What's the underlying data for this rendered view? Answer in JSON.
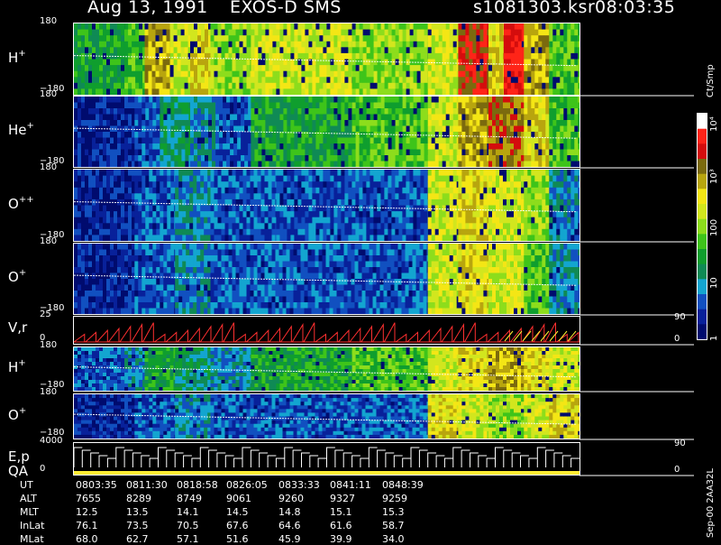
{
  "title": {
    "date": "Aug 13, 1991",
    "instrument": "EXOS-D SMS",
    "file": "s1081303.ksr",
    "time": "08:03:35"
  },
  "colorbar": {
    "unit": "Ct/Smp",
    "ticks": [
      "1",
      "10",
      "100",
      "10³",
      "10⁴"
    ],
    "colors": [
      "#000b6e",
      "#08219a",
      "#1150c0",
      "#13a5d0",
      "#0f8a55",
      "#0f9e2e",
      "#3ec41a",
      "#8ddd1c",
      "#d2e61e",
      "#f4e615",
      "#b8a50e",
      "#7b6a0e",
      "#d40d0d",
      "#ff2418",
      "#ffffff"
    ]
  },
  "bottom_label": "Sep-00  2AA32L",
  "panels": [
    {
      "id": "h1",
      "label": "H",
      "charge": "+",
      "ymax": "180",
      "ymin": "−180"
    },
    {
      "id": "he",
      "label": "He",
      "charge": "+",
      "ymax": "180",
      "ymin": "−180"
    },
    {
      "id": "oo",
      "label": "O",
      "charge": "++",
      "ymax": "180",
      "ymin": "−180"
    },
    {
      "id": "o1",
      "label": "O",
      "charge": "+",
      "ymax": "180",
      "ymin": "−180"
    },
    {
      "id": "vr",
      "label": "V,r",
      "charge": "",
      "ymax": "25",
      "ymin": "0",
      "right_top": "90",
      "right_bottom": "0"
    },
    {
      "id": "h2",
      "label": "H",
      "charge": "+",
      "ymax": "180",
      "ymin": "−180"
    },
    {
      "id": "o2",
      "label": "O",
      "charge": "+",
      "ymax": "180",
      "ymin": "−180"
    },
    {
      "id": "ep",
      "label": "E,p",
      "label2": "QA",
      "charge": "",
      "ymax": "4000",
      "ymin": "0",
      "right_top": "90",
      "right_bottom": "0"
    }
  ],
  "ephemeris": {
    "rows": [
      {
        "name": "UT",
        "values": [
          "0803:35",
          "0811:30",
          "0818:58",
          "0826:05",
          "0833:33",
          "0841:11",
          "0848:39"
        ]
      },
      {
        "name": "ALT",
        "values": [
          "7655",
          "8289",
          "8749",
          "9061",
          "9260",
          "9327",
          "9259"
        ]
      },
      {
        "name": "MLT",
        "values": [
          "12.5",
          "13.5",
          "14.1",
          "14.5",
          "14.8",
          "15.1",
          "15.3"
        ]
      },
      {
        "name": "InLat",
        "values": [
          "76.1",
          "73.5",
          "70.5",
          "67.6",
          "64.6",
          "61.6",
          "58.7"
        ]
      },
      {
        "name": "MLat",
        "values": [
          "68.0",
          "62.7",
          "57.1",
          "51.6",
          "45.9",
          "39.9",
          "34.0"
        ]
      }
    ]
  },
  "chart_data": {
    "type": "heatmap",
    "x_axis": "UT",
    "x_ticks": [
      "0803:35",
      "0811:30",
      "0818:58",
      "0826:05",
      "0833:33",
      "0841:11",
      "0848:39"
    ],
    "colorbar_range": [
      1,
      10000
    ],
    "colorbar_scale": "log",
    "panels": [
      {
        "name": "H+",
        "ylim": [
          -180,
          180
        ],
        "segments": [
          {
            "x0": 0.0,
            "x1": 0.1,
            "level": 5
          },
          {
            "x0": 0.1,
            "x1": 0.14,
            "level": 6
          },
          {
            "x0": 0.14,
            "x1": 0.19,
            "level": 10
          },
          {
            "x0": 0.19,
            "x1": 0.23,
            "level": 8
          },
          {
            "x0": 0.23,
            "x1": 0.27,
            "level": 9
          },
          {
            "x0": 0.27,
            "x1": 0.35,
            "level": 7
          },
          {
            "x0": 0.35,
            "x1": 0.55,
            "level": 8
          },
          {
            "x0": 0.55,
            "x1": 0.7,
            "level": 7
          },
          {
            "x0": 0.7,
            "x1": 0.76,
            "level": 8
          },
          {
            "x0": 0.76,
            "x1": 0.82,
            "level": 12
          },
          {
            "x0": 0.82,
            "x1": 0.85,
            "level": 9
          },
          {
            "x0": 0.85,
            "x1": 0.89,
            "level": 13
          },
          {
            "x0": 0.89,
            "x1": 0.94,
            "level": 10
          },
          {
            "x0": 0.94,
            "x1": 1.0,
            "level": 6
          }
        ]
      },
      {
        "name": "He+",
        "ylim": [
          -180,
          180
        ],
        "segments": [
          {
            "x0": 0.0,
            "x1": 0.12,
            "level": 1
          },
          {
            "x0": 0.12,
            "x1": 0.17,
            "level": 2
          },
          {
            "x0": 0.17,
            "x1": 0.23,
            "level": 4
          },
          {
            "x0": 0.23,
            "x1": 0.28,
            "level": 3
          },
          {
            "x0": 0.28,
            "x1": 0.35,
            "level": 2
          },
          {
            "x0": 0.35,
            "x1": 0.55,
            "level": 5
          },
          {
            "x0": 0.55,
            "x1": 0.7,
            "level": 6
          },
          {
            "x0": 0.7,
            "x1": 0.76,
            "level": 8
          },
          {
            "x0": 0.76,
            "x1": 0.82,
            "level": 10
          },
          {
            "x0": 0.82,
            "x1": 0.89,
            "level": 11
          },
          {
            "x0": 0.89,
            "x1": 0.94,
            "level": 9
          },
          {
            "x0": 0.94,
            "x1": 1.0,
            "level": 6
          }
        ]
      },
      {
        "name": "O++",
        "ylim": [
          -180,
          180
        ],
        "segments": [
          {
            "x0": 0.0,
            "x1": 0.12,
            "level": 1
          },
          {
            "x0": 0.12,
            "x1": 0.2,
            "level": 2
          },
          {
            "x0": 0.2,
            "x1": 0.27,
            "level": 3
          },
          {
            "x0": 0.27,
            "x1": 0.4,
            "level": 2
          },
          {
            "x0": 0.4,
            "x1": 0.7,
            "level": 2
          },
          {
            "x0": 0.7,
            "x1": 0.76,
            "level": 8
          },
          {
            "x0": 0.76,
            "x1": 0.82,
            "level": 9
          },
          {
            "x0": 0.82,
            "x1": 0.89,
            "level": 8
          },
          {
            "x0": 0.89,
            "x1": 0.94,
            "level": 7
          },
          {
            "x0": 0.94,
            "x1": 1.0,
            "level": 3
          }
        ]
      },
      {
        "name": "O+",
        "ylim": [
          -180,
          180
        ],
        "segments": [
          {
            "x0": 0.0,
            "x1": 0.12,
            "level": 1
          },
          {
            "x0": 0.12,
            "x1": 0.2,
            "level": 2
          },
          {
            "x0": 0.2,
            "x1": 0.27,
            "level": 3
          },
          {
            "x0": 0.27,
            "x1": 0.7,
            "level": 2
          },
          {
            "x0": 0.7,
            "x1": 0.76,
            "level": 8
          },
          {
            "x0": 0.76,
            "x1": 0.82,
            "level": 9
          },
          {
            "x0": 0.82,
            "x1": 0.89,
            "level": 8
          },
          {
            "x0": 0.89,
            "x1": 0.94,
            "level": 6
          },
          {
            "x0": 0.94,
            "x1": 1.0,
            "level": 3
          }
        ]
      },
      {
        "name": "H+ (2)",
        "ylim": [
          -180,
          180
        ],
        "segments": [
          {
            "x0": 0.0,
            "x1": 0.1,
            "level": 2
          },
          {
            "x0": 0.1,
            "x1": 0.14,
            "level": 3
          },
          {
            "x0": 0.14,
            "x1": 0.2,
            "level": 5
          },
          {
            "x0": 0.2,
            "x1": 0.27,
            "level": 4
          },
          {
            "x0": 0.27,
            "x1": 0.35,
            "level": 3
          },
          {
            "x0": 0.35,
            "x1": 0.55,
            "level": 5
          },
          {
            "x0": 0.55,
            "x1": 0.7,
            "level": 6
          },
          {
            "x0": 0.7,
            "x1": 0.76,
            "level": 8
          },
          {
            "x0": 0.76,
            "x1": 0.82,
            "level": 9
          },
          {
            "x0": 0.82,
            "x1": 0.89,
            "level": 10
          },
          {
            "x0": 0.89,
            "x1": 0.94,
            "level": 9
          },
          {
            "x0": 0.94,
            "x1": 1.0,
            "level": 8
          }
        ]
      },
      {
        "name": "O+ (2)",
        "ylim": [
          -180,
          180
        ],
        "segments": [
          {
            "x0": 0.0,
            "x1": 0.12,
            "level": 1
          },
          {
            "x0": 0.12,
            "x1": 0.2,
            "level": 2
          },
          {
            "x0": 0.2,
            "x1": 0.27,
            "level": 3
          },
          {
            "x0": 0.27,
            "x1": 0.7,
            "level": 2
          },
          {
            "x0": 0.7,
            "x1": 0.76,
            "level": 9
          },
          {
            "x0": 0.76,
            "x1": 0.82,
            "level": 8
          },
          {
            "x0": 0.82,
            "x1": 0.89,
            "level": 7
          },
          {
            "x0": 0.89,
            "x1": 0.94,
            "level": 8
          },
          {
            "x0": 0.94,
            "x1": 1.0,
            "level": 9
          }
        ]
      }
    ],
    "line_panels": [
      {
        "name": "V,r",
        "ylim": [
          0,
          25
        ],
        "right_ylim": [
          0,
          90
        ]
      },
      {
        "name": "E,p QA",
        "ylim": [
          0,
          4000
        ],
        "right_ylim": [
          0,
          90
        ]
      }
    ]
  }
}
